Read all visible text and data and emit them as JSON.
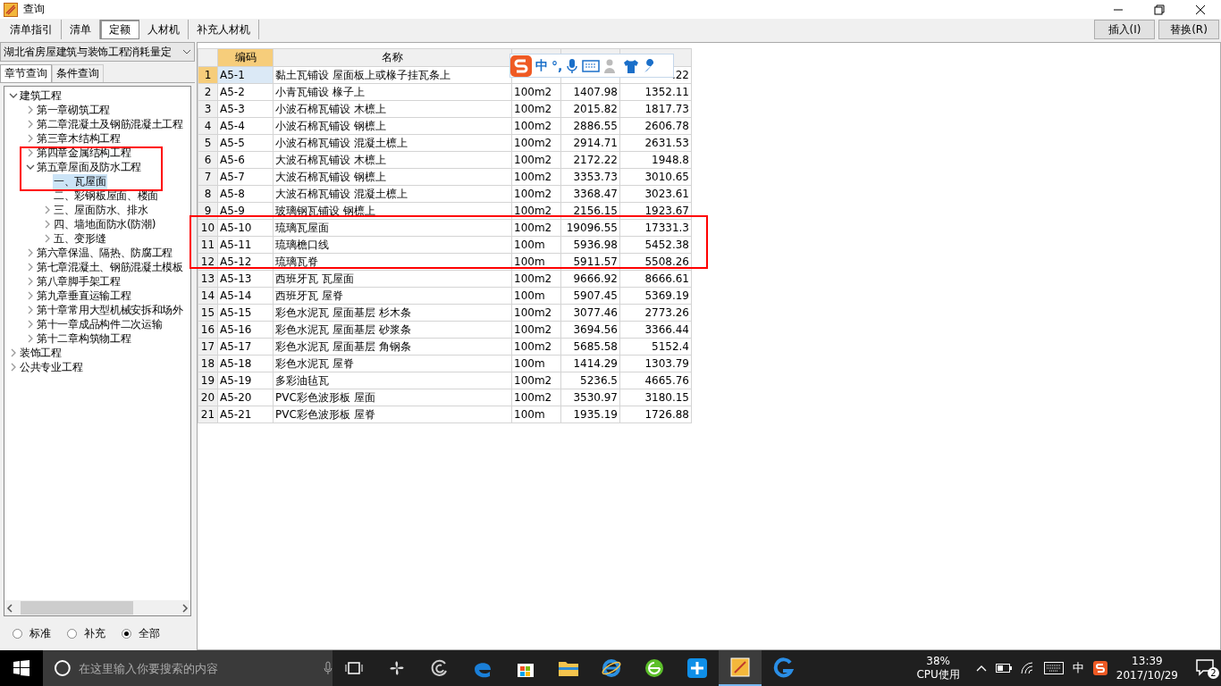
{
  "window": {
    "title": "查询"
  },
  "tabs": [
    {
      "label": "清单指引",
      "selected": false
    },
    {
      "label": "清单",
      "selected": false
    },
    {
      "label": "定额",
      "selected": true
    },
    {
      "label": "人材机",
      "selected": false
    },
    {
      "label": "补充人材机",
      "selected": false
    }
  ],
  "actions": [
    "插入(I)",
    "替换(R)"
  ],
  "library": {
    "value": "湖北省房屋建筑与装饰工程消耗量定"
  },
  "query_tabs": [
    {
      "label": "章节查询",
      "selected": true
    },
    {
      "label": "条件查询",
      "selected": false
    }
  ],
  "tree": [
    {
      "label": "建筑工程",
      "kind": "branch",
      "expanded": true,
      "selected": false,
      "children": [
        {
          "label": "第一章砌筑工程",
          "kind": "branch",
          "expanded": false,
          "selected": false
        },
        {
          "label": "第二章混凝土及钢筋混凝土工程",
          "kind": "branch",
          "expanded": false,
          "selected": false
        },
        {
          "label": "第三章木结构工程",
          "kind": "branch",
          "expanded": false,
          "selected": false
        },
        {
          "label": "第四章金属结构工程",
          "kind": "branch",
          "expanded": false,
          "selected": false
        },
        {
          "label": "第五章屋面及防水工程",
          "kind": "branch",
          "expanded": true,
          "selected": false,
          "children": [
            {
              "label": "一、瓦屋面",
              "kind": "leaf",
              "selected": true
            },
            {
              "label": "二、彩钢板屋面、楼面",
              "kind": "leaf",
              "selected": false
            },
            {
              "label": "三、屋面防水、排水",
              "kind": "branch",
              "expanded": false,
              "selected": false
            },
            {
              "label": "四、墙地面防水(防潮)",
              "kind": "branch",
              "expanded": false,
              "selected": false
            },
            {
              "label": "五、变形缝",
              "kind": "branch",
              "expanded": false,
              "selected": false
            }
          ]
        },
        {
          "label": "第六章保温、隔热、防腐工程",
          "kind": "branch",
          "expanded": false,
          "selected": false
        },
        {
          "label": "第七章混凝土、钢筋混凝土模板",
          "kind": "branch",
          "expanded": false,
          "selected": false
        },
        {
          "label": "第八章脚手架工程",
          "kind": "branch",
          "expanded": false,
          "selected": false
        },
        {
          "label": "第九章垂直运输工程",
          "kind": "branch",
          "expanded": false,
          "selected": false
        },
        {
          "label": "第十章常用大型机械安拆和场外",
          "kind": "branch",
          "expanded": false,
          "selected": false
        },
        {
          "label": "第十一章成品构件二次运输",
          "kind": "branch",
          "expanded": false,
          "selected": false
        },
        {
          "label": "第十二章构筑物工程",
          "kind": "branch",
          "expanded": false,
          "selected": false
        }
      ]
    },
    {
      "label": "装饰工程",
      "kind": "branch",
      "expanded": false,
      "selected": false
    },
    {
      "label": "公共专业工程",
      "kind": "branch",
      "expanded": false,
      "selected": false
    }
  ],
  "filters": [
    {
      "label": "标准",
      "selected": false
    },
    {
      "label": "补充",
      "selected": false
    },
    {
      "label": "全部",
      "selected": true
    }
  ],
  "table": {
    "columns": [
      "编码",
      "名称"
    ],
    "rows": [
      {
        "index": "1",
        "code": "A5-1",
        "name": "黏土瓦铺设 屋面板上或椽子挂瓦条上",
        "price_notax": ".22",
        "selected": true
      },
      {
        "index": "2",
        "code": "A5-2",
        "name": "小青瓦铺设 椽子上",
        "unit": "100m2",
        "price_tax": "1407.98",
        "price_notax": "1352.11",
        "selected": false
      },
      {
        "index": "3",
        "code": "A5-3",
        "name": "小波石棉瓦铺设 木檩上",
        "unit": "100m2",
        "price_tax": "2015.82",
        "price_notax": "1817.73",
        "selected": false
      },
      {
        "index": "4",
        "code": "A5-4",
        "name": "小波石棉瓦铺设 钢檩上",
        "unit": "100m2",
        "price_tax": "2886.55",
        "price_notax": "2606.78",
        "selected": false
      },
      {
        "index": "5",
        "code": "A5-5",
        "name": "小波石棉瓦铺设 混凝土檩上",
        "unit": "100m2",
        "price_tax": "2914.71",
        "price_notax": "2631.53",
        "selected": false
      },
      {
        "index": "6",
        "code": "A5-6",
        "name": "大波石棉瓦铺设 木檩上",
        "unit": "100m2",
        "price_tax": "2172.22",
        "price_notax": "1948.8",
        "selected": false
      },
      {
        "index": "7",
        "code": "A5-7",
        "name": "大波石棉瓦铺设 钢檩上",
        "unit": "100m2",
        "price_tax": "3353.73",
        "price_notax": "3010.65",
        "selected": false
      },
      {
        "index": "8",
        "code": "A5-8",
        "name": "大波石棉瓦铺设 混凝土檩上",
        "unit": "100m2",
        "price_tax": "3368.47",
        "price_notax": "3023.61",
        "selected": false
      },
      {
        "index": "9",
        "code": "A5-9",
        "name": "玻璃钢瓦铺设 钢檩上",
        "unit": "100m2",
        "price_tax": "2156.15",
        "price_notax": "1923.67",
        "selected": false
      },
      {
        "index": "10",
        "code": "A5-10",
        "name": "琉璃瓦屋面",
        "unit": "100m2",
        "price_tax": "19096.55",
        "price_notax": "17331.3",
        "selected": false
      },
      {
        "index": "11",
        "code": "A5-11",
        "name": "琉璃檐口线",
        "unit": "100m",
        "price_tax": "5936.98",
        "price_notax": "5452.38",
        "selected": false
      },
      {
        "index": "12",
        "code": "A5-12",
        "name": "琉璃瓦脊",
        "unit": "100m",
        "price_tax": "5911.57",
        "price_notax": "5508.26",
        "selected": false
      },
      {
        "index": "13",
        "code": "A5-13",
        "name": "西班牙瓦 瓦屋面",
        "unit": "100m2",
        "price_tax": "9666.92",
        "price_notax": "8666.61",
        "selected": false
      },
      {
        "index": "14",
        "code": "A5-14",
        "name": "西班牙瓦 屋脊",
        "unit": "100m",
        "price_tax": "5907.45",
        "price_notax": "5369.19",
        "selected": false
      },
      {
        "index": "15",
        "code": "A5-15",
        "name": "彩色水泥瓦 屋面基层 杉木条",
        "unit": "100m2",
        "price_tax": "3077.46",
        "price_notax": "2773.26",
        "selected": false
      },
      {
        "index": "16",
        "code": "A5-16",
        "name": "彩色水泥瓦 屋面基层 砂浆条",
        "unit": "100m2",
        "price_tax": "3694.56",
        "price_notax": "3366.44",
        "selected": false
      },
      {
        "index": "17",
        "code": "A5-17",
        "name": "彩色水泥瓦 屋面基层 角钢条",
        "unit": "100m2",
        "price_tax": "5685.58",
        "price_notax": "5152.4",
        "selected": false
      },
      {
        "index": "18",
        "code": "A5-18",
        "name": "彩色水泥瓦 屋脊",
        "unit": "100m",
        "price_tax": "1414.29",
        "price_notax": "1303.79",
        "selected": false
      },
      {
        "index": "19",
        "code": "A5-19",
        "name": "多彩油毡瓦",
        "unit": "100m2",
        "price_tax": "5236.5",
        "price_notax": "4665.76",
        "selected": false
      },
      {
        "index": "20",
        "code": "A5-20",
        "name": "PVC彩色波形板 屋面",
        "unit": "100m2",
        "price_tax": "3530.97",
        "price_notax": "3180.15",
        "selected": false
      },
      {
        "index": "21",
        "code": "A5-21",
        "name": "PVC彩色波形板 屋脊",
        "unit": "100m",
        "price_tax": "1935.19",
        "price_notax": "1726.88",
        "selected": false
      }
    ]
  },
  "ime": {
    "mode": "中",
    "punctuation": "°,"
  },
  "taskbar": {
    "search": {
      "placeholder": "在这里输入你要搜索的内容"
    },
    "cpu": {
      "value": "38%",
      "label": "CPU使用"
    },
    "input_mode": "中",
    "time": "13:39",
    "date": "2017/10/29",
    "notifications": "2"
  }
}
